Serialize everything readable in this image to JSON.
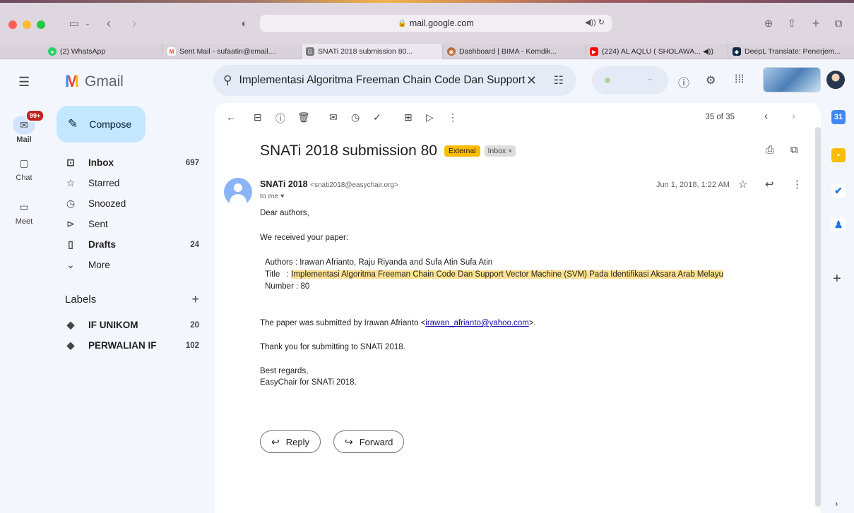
{
  "browser": {
    "url": "mail.google.com",
    "tabs": [
      {
        "label": "(2) WhatsApp",
        "color": "#25d366",
        "glyph": "●"
      },
      {
        "label": "Sent Mail - sufaatin@email....",
        "color": "#ea4335",
        "glyph": "M"
      },
      {
        "label": "SNATi 2018 submission 80...",
        "color": "#7a7a7a",
        "glyph": "G"
      },
      {
        "label": "Dashboard | BIMA - Kemdik...",
        "color": "#b86b3a",
        "glyph": "◉"
      },
      {
        "label": "(224) AL AQLU ( SHOLAWA... ◀))",
        "color": "#ff0000",
        "glyph": "▶"
      },
      {
        "label": "DeepL Translate: Penerjem...",
        "color": "#0f2b46",
        "glyph": "◆"
      }
    ]
  },
  "gmail": {
    "logo_text": "Gmail",
    "search_query": "Implementasi Algoritma Freeman Chain Code Dan Support",
    "rail": {
      "mail": "Mail",
      "badge": "99+",
      "chat": "Chat",
      "meet": "Meet"
    },
    "compose_label": "Compose",
    "nav": [
      {
        "label": "Inbox",
        "count": "697",
        "icon": "inbox-icon",
        "glyph": "⊡",
        "bold": true
      },
      {
        "label": "Starred",
        "count": "",
        "icon": "star-icon",
        "glyph": "☆",
        "bold": false
      },
      {
        "label": "Snoozed",
        "count": "",
        "icon": "clock-icon",
        "glyph": "◷",
        "bold": false
      },
      {
        "label": "Sent",
        "count": "",
        "icon": "send-icon",
        "glyph": "⊳",
        "bold": false
      },
      {
        "label": "Drafts",
        "count": "24",
        "icon": "draft-icon",
        "glyph": "▯",
        "bold": true
      },
      {
        "label": "More",
        "count": "",
        "icon": "chevron-down-icon",
        "glyph": "⌄",
        "bold": false
      }
    ],
    "labels_heading": "Labels",
    "labels": [
      {
        "label": "IF UNIKOM",
        "count": "20"
      },
      {
        "label": "PERWALIAN IF",
        "count": "102"
      }
    ],
    "pager": "35 of 35"
  },
  "email": {
    "subject": "SNATi 2018 submission 80",
    "external_badge": "External",
    "inbox_badge": "Inbox ×",
    "sender_name": "SNATi 2018",
    "sender_email": "<snati2018@easychair.org>",
    "to": "to me ▾",
    "date": "Jun 1, 2018, 1:22 AM",
    "greeting": "Dear authors,",
    "received": "We received your paper:",
    "authors_line": "Authors : Irawan Afrianto, Raju Riyanda and Sufa Atin Sufa Atin",
    "title_prefix": "Title   : ",
    "title_highlight": "Implementasi Algoritma Freeman Chain Code Dan Support Vector Machine (SVM) Pada Identifikasi Aksara Arab Melayu",
    "number_line": "Number  : 80",
    "submitted_prefix": "The paper was submitted by Irawan Afrianto <",
    "submitted_email": "irawan_afrianto@yahoo.com",
    "submitted_suffix": ">.",
    "thanks": "Thank you for submitting to SNATi 2018.",
    "regards": "Best regards,",
    "signature": "EasyChair for SNATi 2018.",
    "reply_label": "Reply",
    "forward_label": "Forward"
  }
}
